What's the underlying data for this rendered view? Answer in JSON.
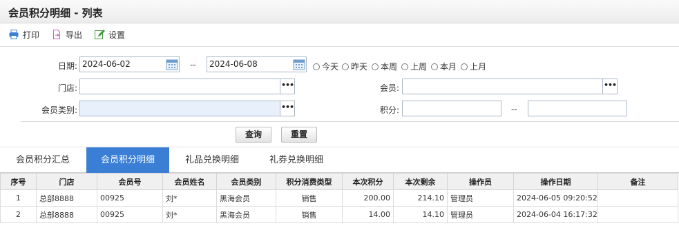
{
  "page": {
    "title": "会员积分明细 - 列表"
  },
  "toolbar": {
    "print": "打印",
    "export": "导出",
    "settings": "设置"
  },
  "form": {
    "date_label": "日期:",
    "date_from": "2024-06-02",
    "date_sep": "--",
    "date_to": "2024-06-08",
    "quick_ranges": [
      "今天",
      "昨天",
      "本周",
      "上周",
      "本月",
      "上月"
    ],
    "store_label": "门店:",
    "store_value": "",
    "member_label": "会员:",
    "member_value": "",
    "member_type_label": "会员类别:",
    "member_type_value": "",
    "points_label": "积分:",
    "points_from": "",
    "points_sep": "--",
    "points_to": "",
    "dots": "•••",
    "query_button": "查询",
    "reset_button": "重置"
  },
  "tabs": [
    "会员积分汇总",
    "会员积分明细",
    "礼品兑换明细",
    "礼券兑换明细"
  ],
  "active_tab": 1,
  "table": {
    "headers": [
      "序号",
      "门店",
      "会员号",
      "会员姓名",
      "会员类别",
      "积分消费类型",
      "本次积分",
      "本次剩余",
      "操作员",
      "操作日期",
      "备注"
    ],
    "rows": [
      [
        "1",
        "总部8888",
        "00925",
        "刘*",
        "黑海会员",
        "销售",
        "200.00",
        "214.10",
        "管理员",
        "2024-06-05 09:20:52",
        ""
      ],
      [
        "2",
        "总部8888",
        "00925",
        "刘*",
        "黑海会员",
        "销售",
        "14.00",
        "14.10",
        "管理员",
        "2024-06-04 16:17:32",
        ""
      ]
    ]
  },
  "colors": {
    "accent": "#3a7fd5",
    "print_icon": "#3a7fd5",
    "export_icon": "#c05fbf",
    "settings_icon": "#3c9a3c"
  },
  "icons": {
    "print": "printer-icon",
    "export": "export-file-icon",
    "settings": "edit-settings-icon",
    "calendar": "calendar-icon"
  }
}
